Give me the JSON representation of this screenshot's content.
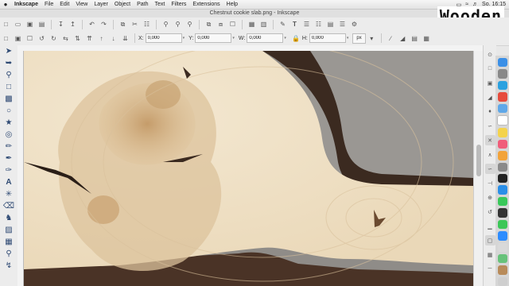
{
  "menubar": {
    "apple_icon": "",
    "app_name": "Inkscape",
    "items": [
      "File",
      "Edit",
      "View",
      "Layer",
      "Object",
      "Path",
      "Text",
      "Filters",
      "Extensions",
      "Help"
    ],
    "clock": "So. 16:15"
  },
  "window": {
    "title": "Chestnut cookie slab.png - Inkscape"
  },
  "watermark": "Wooden",
  "toolbar": {
    "x_label": "X:",
    "x_value": "0,000",
    "y_label": "Y:",
    "y_value": "0,000",
    "w_label": "W:",
    "w_value": "0,000",
    "h_label": "H:",
    "h_value": "0,000",
    "unit": "px"
  },
  "tools": [
    "selector-tool",
    "node-tool",
    "zoom-tool",
    "rectangle-tool",
    "box3d-tool",
    "ellipse-tool",
    "star-tool",
    "spiral-tool",
    "pencil-tool",
    "pen-tool",
    "calligraphy-tool",
    "text-tool",
    "spray-tool",
    "eraser-tool",
    "bucket-tool",
    "gradient-tool",
    "mesh-tool",
    "dropper-tool",
    "connector-tool",
    "measure-tool"
  ],
  "colors": {
    "wood_light": "#efe0c6",
    "wood_dark": "#b98e5e",
    "bark": "#4a3326",
    "stone": "#8d8a86",
    "accent": "#2f4a74"
  }
}
